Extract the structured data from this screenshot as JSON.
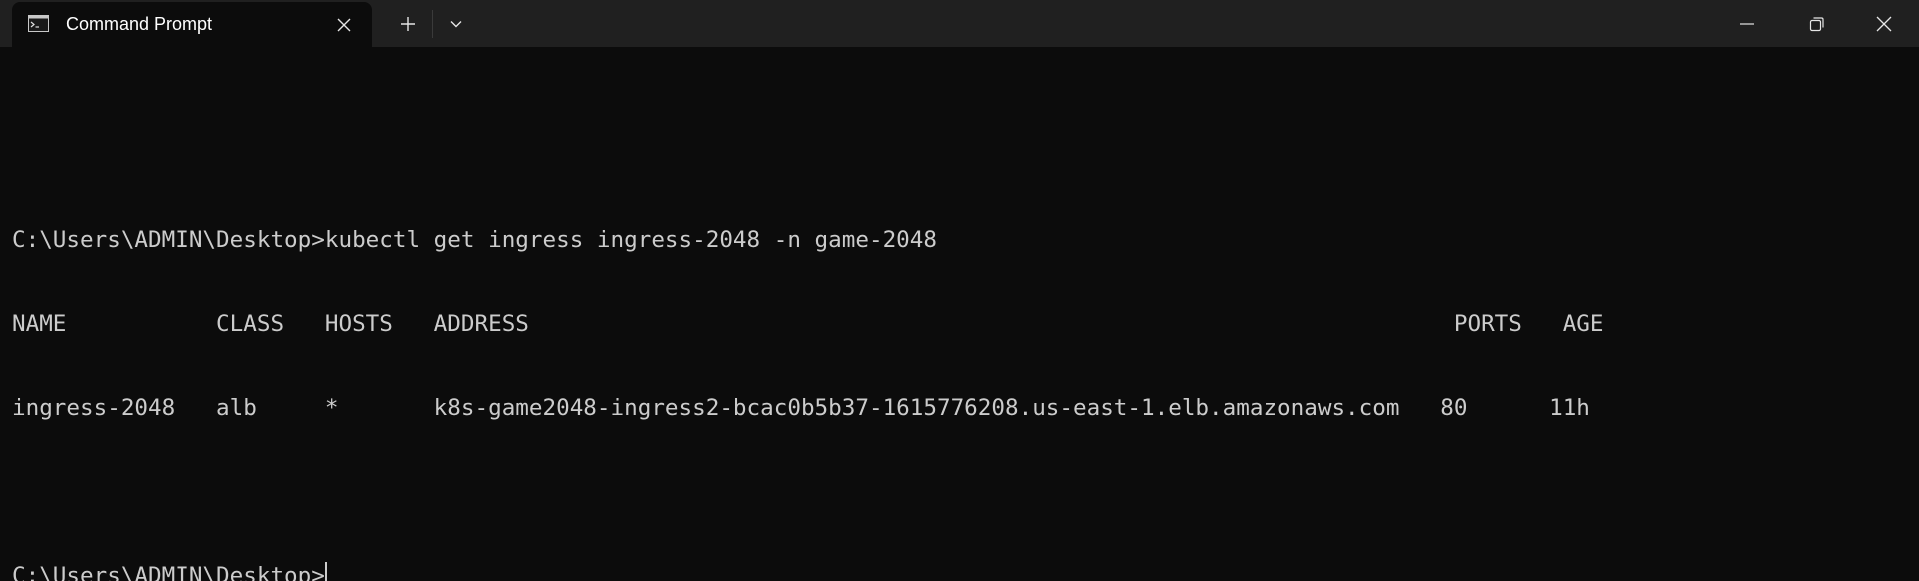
{
  "window": {
    "tab_title": "Command Prompt",
    "icons": {
      "app": "terminal-app-icon",
      "tab_close": "close-icon",
      "new_tab": "plus-icon",
      "dropdown": "chevron-down-icon",
      "minimize": "minimize-icon",
      "maximize": "restore-icon",
      "close": "close-icon"
    }
  },
  "terminal": {
    "lines": [
      "",
      "C:\\Users\\ADMIN\\Desktop>kubectl get ingress ingress-2048 -n game-2048",
      "NAME           CLASS   HOSTS   ADDRESS                                                                    PORTS   AGE",
      "ingress-2048   alb     *       k8s-game2048-ingress2-bcac0b5b37-1615776208.us-east-1.elb.amazonaws.com   80      11h",
      "",
      "C:\\Users\\ADMIN\\Desktop>"
    ]
  },
  "colors": {
    "background": "#0c0c0c",
    "titlebar": "#202020",
    "text": "#cccccc"
  }
}
